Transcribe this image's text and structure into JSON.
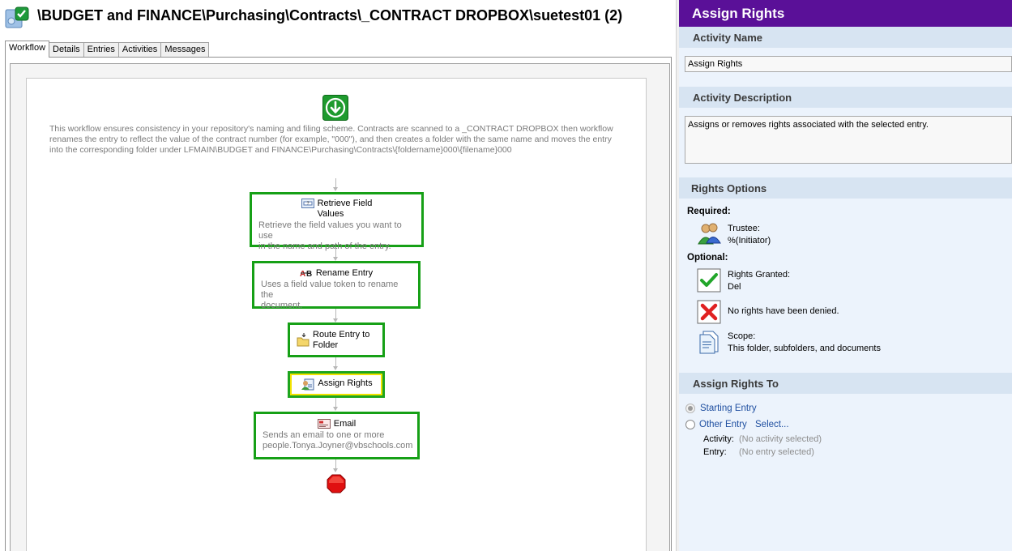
{
  "window": {
    "path_title": "\\BUDGET and FINANCE\\Purchasing\\Contracts\\_CONTRACT DROPBOX\\suetest01 (2)",
    "title_icon": "workflow-check-icon"
  },
  "tabs": [
    {
      "label": "Workflow",
      "active": true
    },
    {
      "label": "Details",
      "active": false
    },
    {
      "label": "Entries",
      "active": false
    },
    {
      "label": "Activities",
      "active": false
    },
    {
      "label": "Messages",
      "active": false
    }
  ],
  "workflow": {
    "start_icon": "start-arrow-icon",
    "description": "This workflow ensures consistency in your repository's naming and filing scheme. Contracts are scanned to a _CONTRACT DROPBOX then workflow renames the entry to reflect the value of the contract number (for example, \"000\"), and then creates a folder with the same name and moves the entry into the corresponding folder under LFMAIN\\BUDGET and FINANCE\\Purchasing\\Contracts\\{foldername}000\\{filename}000",
    "activities": [
      {
        "title": "Retrieve Field Values",
        "title_line1": "Retrieve Field",
        "title_line2": "Values",
        "desc_line1": "Retrieve the field values you want to use",
        "desc_line2": "in the name and path of the entry.",
        "icon": "field-values-icon"
      },
      {
        "title": "Rename Entry",
        "desc_line1": "Uses a field value token to rename the",
        "desc_line2": "document.",
        "icon": "rename-icon"
      },
      {
        "title": "Route Entry to Folder",
        "title_line1": "Route Entry to",
        "title_line2": "Folder",
        "icon": "folder-route-icon"
      },
      {
        "title": "Assign Rights",
        "icon": "assign-rights-icon",
        "selected": true
      },
      {
        "title": "Email",
        "desc_line1": "Sends an email to one or more",
        "desc_line2": "people.Tonya.Joyner@vbschools.com",
        "icon": "email-icon"
      }
    ],
    "stop_icon": "stop-icon"
  },
  "panel": {
    "header": "Assign Rights",
    "activity_name_section": "Activity Name",
    "activity_name_value": "Assign Rights",
    "activity_description_section": "Activity Description",
    "activity_description_value": "Assigns or removes rights associated with the selected entry.",
    "rights_options_section": "Rights Options",
    "required_label": "Required:",
    "trustee_label": "Trustee:",
    "trustee_value": "%(Initiator)",
    "optional_label": "Optional:",
    "rights_granted_label": "Rights Granted:",
    "rights_granted_value": "Del",
    "rights_denied_text": "No rights have been denied.",
    "scope_label": "Scope:",
    "scope_value": "This folder, subfolders, and documents",
    "assign_rights_to_section": "Assign Rights To",
    "starting_entry_label": "Starting Entry",
    "other_entry_label": "Other Entry",
    "select_link": "Select...",
    "activity_label": "Activity:",
    "activity_value": "(No activity selected)",
    "entry_label": "Entry:",
    "entry_value": "(No entry selected)"
  },
  "colors": {
    "header_purple": "#5a1098",
    "section_blue": "#d7e4f2",
    "panel_bg": "#ecf3fc",
    "activity_border_green": "#16a016",
    "selected_highlight_yellow": "#f2e200",
    "link_blue": "#1f4fa0"
  }
}
